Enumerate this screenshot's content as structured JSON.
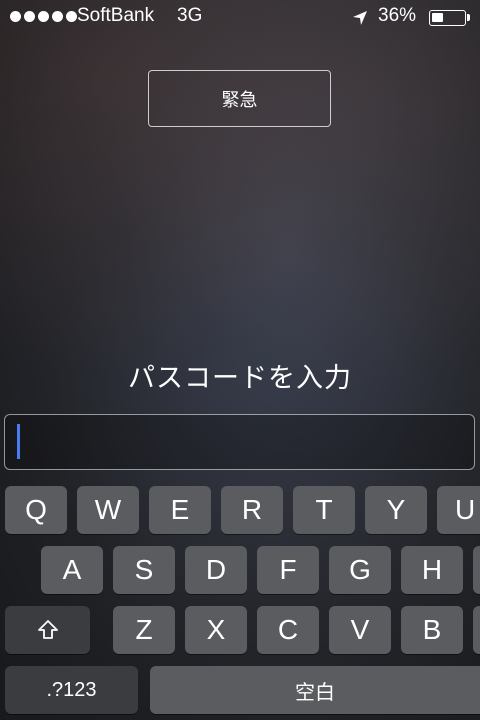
{
  "status_bar": {
    "carrier": "SoftBank",
    "network": "3G",
    "battery_percent": "36%",
    "battery_level": 0.36,
    "icons": [
      "signal-dots",
      "location-arrow-icon",
      "battery-icon"
    ]
  },
  "emergency": {
    "label": "緊急"
  },
  "prompt": {
    "text": "パスコードを入力"
  },
  "passcode": {
    "value": ""
  },
  "keyboard": {
    "row1": [
      "Q",
      "W",
      "E",
      "R",
      "T",
      "Y",
      "U"
    ],
    "row2": [
      "A",
      "S",
      "D",
      "F",
      "G",
      "H"
    ],
    "row3": [
      "Z",
      "X",
      "C",
      "V",
      "B"
    ],
    "numbers_label": ".?123",
    "space_label": "空白",
    "shift_icon": "shift-arrow-icon"
  },
  "colors": {
    "cursor": "#4a7bf0",
    "key": "#5b5c60",
    "key_dark": "#3b3c40"
  }
}
